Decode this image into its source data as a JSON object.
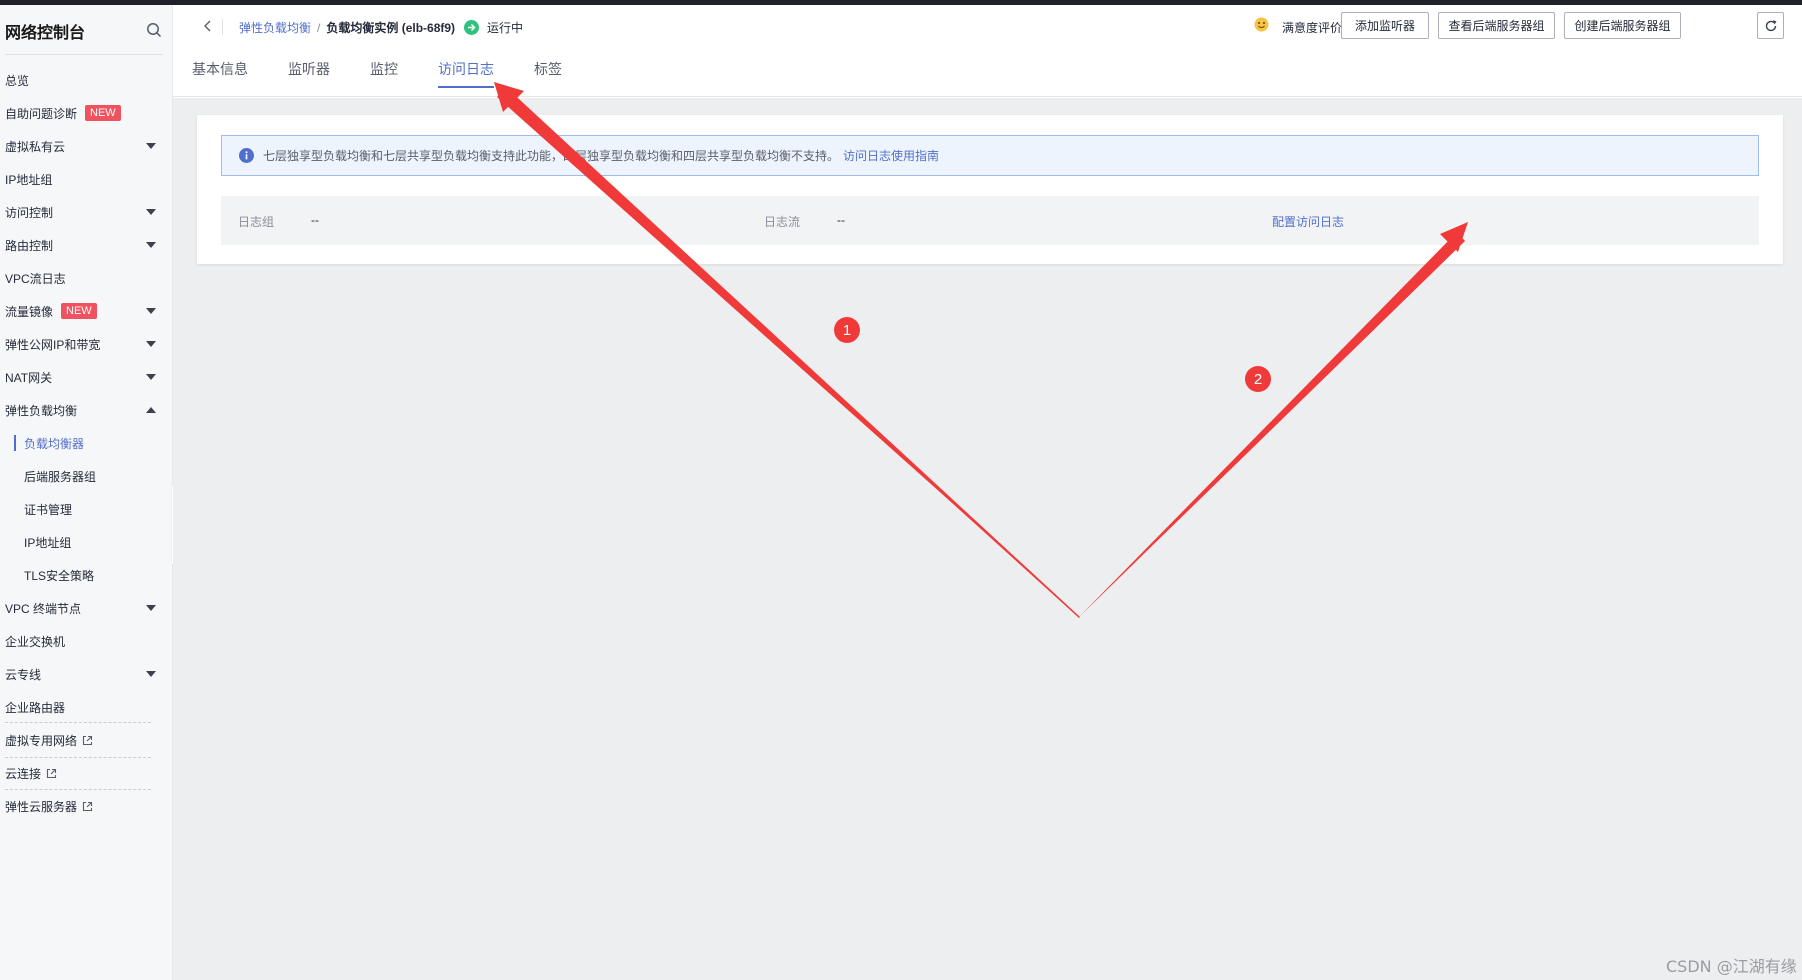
{
  "sidebar": {
    "title": "网络控制台",
    "items": [
      {
        "label": "总览"
      },
      {
        "label": "自助问题诊断",
        "badge": "NEW"
      },
      {
        "label": "虚拟私有云"
      },
      {
        "label": "IP地址组"
      },
      {
        "label": "访问控制"
      },
      {
        "label": "路由控制"
      },
      {
        "label": "VPC流日志"
      },
      {
        "label": "流量镜像",
        "badge": "NEW"
      },
      {
        "label": "弹性公网IP和带宽"
      },
      {
        "label": "NAT网关"
      },
      {
        "label": "弹性负载均衡"
      },
      {
        "label": "负载均衡器"
      },
      {
        "label": "后端服务器组"
      },
      {
        "label": "证书管理"
      },
      {
        "label": "IP地址组"
      },
      {
        "label": "TLS安全策略"
      },
      {
        "label": "VPC 终端节点"
      },
      {
        "label": "企业交换机"
      },
      {
        "label": "云专线"
      },
      {
        "label": "企业路由器"
      },
      {
        "label": "虚拟专用网络"
      },
      {
        "label": "云连接"
      },
      {
        "label": "弹性云服务器"
      }
    ]
  },
  "header": {
    "breadcrumb": {
      "parent": "弹性负载均衡",
      "separator": "/",
      "current": "负载均衡实例 (elb-68f9)"
    },
    "status": "运行中",
    "rating": "满意度评价",
    "buttons": {
      "add_listener": "添加监听器",
      "view_backend": "查看后端服务器组",
      "create_backend": "创建后端服务器组"
    },
    "tabs": [
      "基本信息",
      "监听器",
      "监控",
      "访问日志",
      "标签"
    ]
  },
  "main": {
    "info": {
      "text": "七层独享型负载均衡和七层共享型负载均衡支持此功能，四层独享型负载均衡和四层共享型负载均衡不支持。",
      "link": "访问日志使用指南"
    },
    "log_row": {
      "log_group_label": "日志组",
      "log_group_value": "--",
      "log_stream_label": "日志流",
      "log_stream_value": "--",
      "config_link": "配置访问日志"
    }
  },
  "annotations": {
    "marker1": "1",
    "marker2": "2",
    "color": "#f03a3a"
  },
  "watermark": "CSDN @江湖有缘",
  "colors": {
    "accent": "#526ecc",
    "status_ok": "#2ec27e",
    "badge": "#f0525f"
  }
}
